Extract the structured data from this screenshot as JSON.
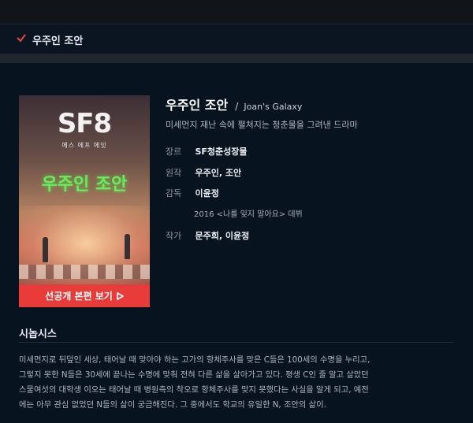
{
  "header": {
    "title": "우주인 조안",
    "accent_color": "#e8473f"
  },
  "poster": {
    "logo": "SF8",
    "logo_sub": "에스 에프 에잇",
    "title": "우주인 조안",
    "cta_label": "선공개 본편 보기",
    "cta_color": "#ea3b3b",
    "title_color": "#66ee5a"
  },
  "info": {
    "title_ko": "우주인 조안",
    "title_sep": "/",
    "title_en": "Joan's Galaxy",
    "logline": "미세먼지 재난 속에 펼쳐지는 청춘물을 그려낸 드라마",
    "genre_label": "장르",
    "genre_value": "SF청춘성장물",
    "original_label": "원작",
    "original_value": "우주인, 조안",
    "director_label": "감독",
    "director_value": "이윤정",
    "debut_note": "2016 <나를 잊지 말아요> 데뷔",
    "writer_label": "작가",
    "writer_value": "문주희, 이윤정"
  },
  "synopsis": {
    "heading": "시놉시스",
    "lines": [
      "미세먼지로 뒤덮인 세상, 태어날 때 맞아야 하는 고가의 항체주사를 맞은 C들은 100세의 수명을 누리고,",
      "그렇지 못한 N들은 30세에 끝나는 수명에 맞춰 전혀 다른 삶을 살아가고 있다. 평생 C인 줄 알고 살았던",
      "스물여섯의 대학생 이오는 태어날 때 병원측의 착오로 항체주사를 맞지 못했다는 사실을 알게 되고, 예전",
      "에는 아무 관심 없었던 N들의 삶이 궁금해진다. 그 중에서도 학교의 유일한 N, 조안의 삶이."
    ]
  }
}
